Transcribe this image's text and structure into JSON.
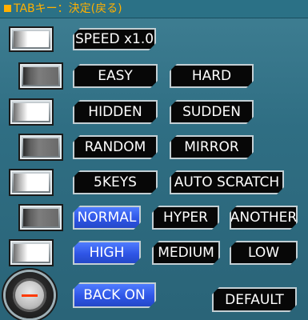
{
  "header": {
    "title": "TABキー：決定(戻る)"
  },
  "options": {
    "speed": "SPEED x1.0",
    "easy": "EASY",
    "hard": "HARD",
    "hidden": "HIDDEN",
    "sudden": "SUDDEN",
    "random": "RANDOM",
    "mirror": "MIRROR",
    "keys5": "5KEYS",
    "auto_scratch": "AUTO SCRATCH",
    "normal": "NORMAL",
    "hyper": "HYPER",
    "another": "ANOTHER",
    "high": "HIGH",
    "medium": "MEDIUM",
    "low": "LOW",
    "back_on": "BACK ON",
    "default": "DEFAULT"
  },
  "toggles": [
    "on",
    "off",
    "on",
    "off",
    "on",
    "off",
    "on"
  ],
  "icons": {
    "header_marker": "square-marker-icon",
    "dial": "minus-knob-icon"
  },
  "colors": {
    "header_text": "#ffb000",
    "background": "#2f6e83",
    "selected": "#3b64f2",
    "minus_mark": "#ff3a00"
  }
}
